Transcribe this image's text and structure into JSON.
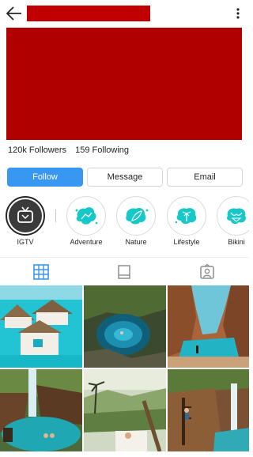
{
  "header": {
    "back_icon": "arrow-left-icon",
    "more_icon": "vertical-dots-icon",
    "username_redaction_color": "#c00000"
  },
  "bio": {
    "redaction_color": "#b00000"
  },
  "stats": {
    "followers_count": "120k",
    "followers_label": "Followers",
    "following_count": "159",
    "following_label": "Following"
  },
  "actions": {
    "follow_label": "Follow",
    "message_label": "Message",
    "email_label": "Email",
    "accent_color": "#3897f0"
  },
  "highlights": [
    {
      "label": "IGTV",
      "icon": "tv-icon"
    },
    {
      "label": "Adventure",
      "icon": "map-splash-icon"
    },
    {
      "label": "Nature",
      "icon": "leaf-splash-icon"
    },
    {
      "label": "Lifestyle",
      "icon": "palm-splash-icon"
    },
    {
      "label": "Bikini",
      "icon": "bikini-splash-icon"
    }
  ],
  "tabs": [
    {
      "name": "grid",
      "icon": "grid-icon",
      "active": true
    },
    {
      "name": "igtv",
      "icon": "igtv-tab-icon",
      "active": false
    },
    {
      "name": "tagged",
      "icon": "tagged-person-icon",
      "active": false
    }
  ],
  "posts": [
    {
      "subject": "overwater bungalows with turquoise water"
    },
    {
      "subject": "swimmer in a blue cenote pool"
    },
    {
      "subject": "sea cave with turquoise water"
    },
    {
      "subject": "waterfall pool in the jungle"
    },
    {
      "subject": "tropical valley viewpoint"
    },
    {
      "subject": "person in front of a cliff waterfall"
    }
  ]
}
